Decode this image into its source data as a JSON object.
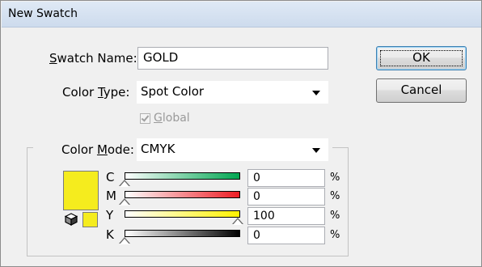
{
  "window": {
    "title": "New Swatch"
  },
  "swatch_name": {
    "label": "Swatch Name:",
    "mnemonic": "S",
    "rest": "watch Name:",
    "value": "GOLD"
  },
  "color_type": {
    "label_pre": "Color ",
    "mnemonic": "T",
    "label_post": "ype:",
    "value": "Spot Color"
  },
  "global": {
    "mnemonic": "G",
    "rest": "lobal",
    "checked": true,
    "enabled": false
  },
  "color_mode": {
    "label_pre": "Color ",
    "mnemonic": "M",
    "label_post": "ode:",
    "value": "CMYK"
  },
  "buttons": {
    "ok": "OK",
    "cancel": "Cancel"
  },
  "swatch_color": "#f5ec1e",
  "channels": [
    {
      "name": "C",
      "value": "0",
      "unit": "%",
      "gradient": [
        "#ffffff",
        "#00a651"
      ]
    },
    {
      "name": "M",
      "value": "0",
      "unit": "%",
      "gradient": [
        "#ffffff",
        "#ed1c24"
      ]
    },
    {
      "name": "Y",
      "value": "100",
      "unit": "%",
      "gradient": [
        "#ffffff",
        "#fff200"
      ]
    },
    {
      "name": "K",
      "value": "0",
      "unit": "%",
      "gradient": [
        "#ffffff",
        "#000000"
      ]
    }
  ],
  "icons": {
    "out_of_gamut": "cube-icon"
  }
}
